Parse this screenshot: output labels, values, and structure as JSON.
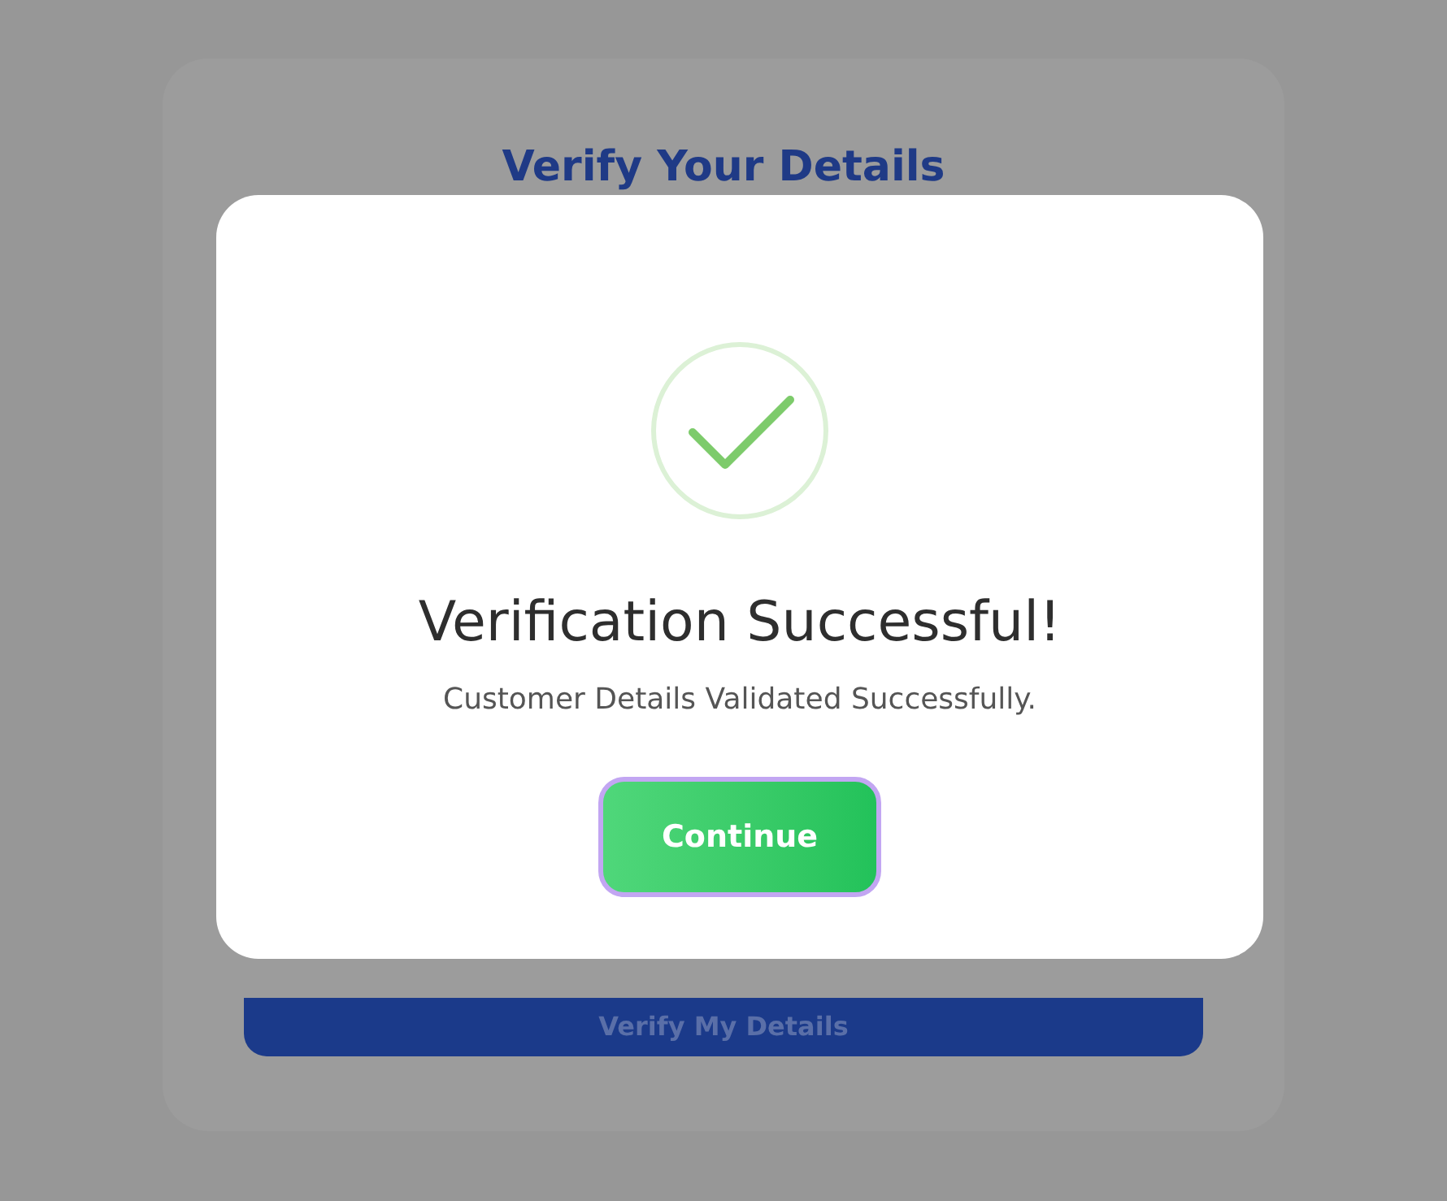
{
  "background_card": {
    "title": "Verify Your Details",
    "button": "Verify My Details"
  },
  "dialog": {
    "title": "Verification Successful!",
    "message": "Customer Details Validated Successfully.",
    "button": "Continue"
  }
}
